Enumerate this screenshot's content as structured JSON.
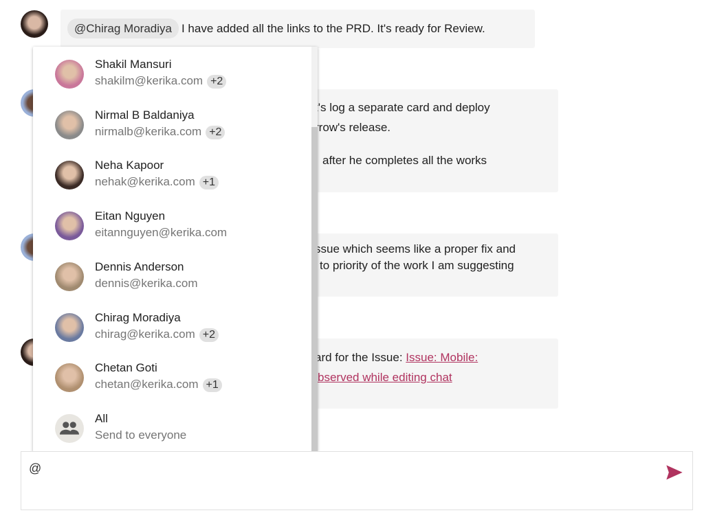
{
  "messages": [
    {
      "mention": "@Chirag Moradiya",
      "text": "I have added all the links to the PRD. It's ready for Review."
    },
    {
      "lines": [
        "t's log a separate card and deploy",
        "rrow's release.",
        "after he completes all the works"
      ]
    },
    {
      "lines": [
        "ssue which seems like a proper fix and",
        "to priority of the work I am suggesting"
      ]
    },
    {
      "prefix": "ard for the Issue: ",
      "link1": "Issue: Mobile:",
      "link2": "bserved while editing chat"
    }
  ],
  "mention_list": [
    {
      "name": "Shakil Mansuri",
      "email": "shakilm@kerika.com",
      "badge": "+2",
      "color": "#c9779a"
    },
    {
      "name": "Nirmal B Baldaniya",
      "email": "nirmalb@kerika.com",
      "badge": "+2",
      "color": "#8a8a8a"
    },
    {
      "name": "Neha Kapoor",
      "email": "nehak@kerika.com",
      "badge": "+1",
      "color": "#3a2a25"
    },
    {
      "name": "Eitan Nguyen",
      "email": "eitannguyen@kerika.com",
      "badge": null,
      "color": "#7a5a9a"
    },
    {
      "name": "Dennis Anderson",
      "email": "dennis@kerika.com",
      "badge": null,
      "color": "#a08a70"
    },
    {
      "name": "Chirag Moradiya",
      "email": "chirag@kerika.com",
      "badge": "+2",
      "color": "#6a7aa0"
    },
    {
      "name": "Chetan Goti",
      "email": "chetan@kerika.com",
      "badge": "+1",
      "color": "#b09070"
    },
    {
      "name": "All",
      "email": "Send to everyone",
      "badge": null,
      "icon": "group-icon"
    }
  ],
  "composer": {
    "value": "@",
    "send_icon": "send-icon"
  },
  "colors": {
    "accent": "#b0335f"
  }
}
